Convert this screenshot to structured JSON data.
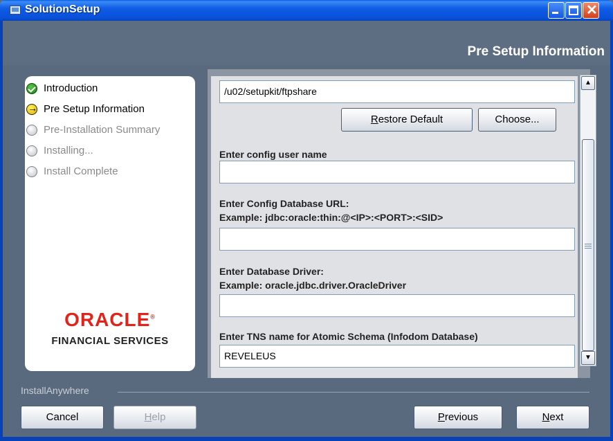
{
  "window": {
    "title": "SolutionSetup",
    "controls": {
      "minimize": "minimize-icon",
      "maximize": "maximize-icon",
      "close": "close-icon"
    }
  },
  "header": {
    "step_title": "Pre Setup Information"
  },
  "steps": [
    {
      "label": "Introduction",
      "state": "done"
    },
    {
      "label": "Pre Setup Information",
      "state": "current"
    },
    {
      "label": "Pre-Installation Summary",
      "state": "pending"
    },
    {
      "label": "Installing...",
      "state": "pending"
    },
    {
      "label": "Install Complete",
      "state": "pending"
    }
  ],
  "logo": {
    "brand": "ORACLE",
    "tagline": "FINANCIAL SERVICES"
  },
  "form": {
    "ftp_share_path": "/u02/setupkit/ftpshare",
    "restore_default_label": "Restore Default",
    "choose_label": "Choose...",
    "config_user_label": "Enter config user name",
    "config_user_value": "",
    "config_db_url_label": "Enter Config Database URL:",
    "config_db_url_example": "Example: jdbc:oracle:thin:@<IP>:<PORT>:<SID>",
    "config_db_url_value": "",
    "db_driver_label": "Enter Database Driver:",
    "db_driver_example": "Example: oracle.jdbc.driver.OracleDriver",
    "db_driver_value": "",
    "tns_label": "Enter TNS name for Atomic Schema (Infodom Database)",
    "tns_value": "REVELEUS"
  },
  "footer": {
    "vendor": "InstallAnywhere",
    "cancel_label": "Cancel",
    "help_label": "Help",
    "previous_label": "Previous",
    "next_label": "Next"
  }
}
